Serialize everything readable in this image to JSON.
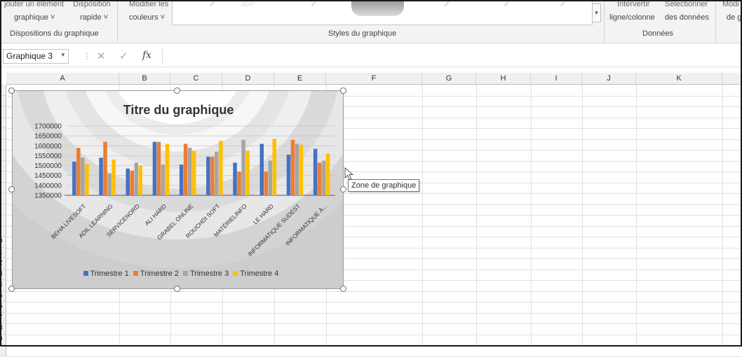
{
  "ribbon": {
    "top_cutoff_1": "jouter un élément",
    "top_cutoff_2": "Disposition",
    "add_element_label": "graphique ˅",
    "quick_layout_label": "rapide ˅",
    "top_cutoff_3": "Modifier les",
    "change_colors_label": "couleurs ˅",
    "switch_top": "Intervertir",
    "switch_label": "ligne/colonne",
    "select_top": "Sélectionner",
    "select_label": "des données",
    "change_top": "Modi",
    "change_label": "de g",
    "group_layouts": "Dispositions du graphique",
    "group_styles": "Styles du graphique",
    "group_data": "Données"
  },
  "formula_bar": {
    "name_box": "Graphique 3",
    "fx": "fx",
    "cancel_icon": "✕",
    "enter_icon": "✓",
    "dots": "⋮"
  },
  "columns": [
    "A",
    "B",
    "C",
    "D",
    "E",
    "F",
    "G",
    "H",
    "I",
    "J",
    "K"
  ],
  "rows": [
    "",
    "",
    "",
    "",
    "",
    "",
    "",
    "",
    "",
    "",
    "",
    "",
    "",
    "",
    "0",
    "1",
    "2",
    "3",
    "4",
    "5",
    "6",
    "7",
    "8",
    "9",
    ""
  ],
  "tooltip": "Zone de graphique",
  "chart_data": {
    "type": "bar",
    "title": "Titre du graphique",
    "categories": [
      "BEHA LIVESOFT",
      "ADIL LEARNING",
      "SERVICENORD",
      "ALI HARD",
      "GRABEL ONLINE",
      "ROUCHDI SOFT",
      "MATÉRIELINFO",
      "LE HARD",
      "INFORMATIQUE SUDEST",
      "INFORMATIQUE À..."
    ],
    "yticks": [
      "1700000",
      "1650000",
      "1600000",
      "1550000",
      "1500000",
      "1450000",
      "1400000",
      "1350000"
    ],
    "ylim": [
      1350000,
      1700000
    ],
    "series": [
      {
        "name": "Trimestre 1",
        "color": "#4472c4",
        "values": [
          1520000,
          1540000,
          1485000,
          1620000,
          1505000,
          1545000,
          1515000,
          1610000,
          1555000,
          1585000
        ]
      },
      {
        "name": "Trimestre 2",
        "color": "#ed7d31",
        "values": [
          1590000,
          1620000,
          1475000,
          1620000,
          1610000,
          1545000,
          1470000,
          1470000,
          1630000,
          1515000
        ]
      },
      {
        "name": "Trimestre 3",
        "color": "#a5a5a5",
        "values": [
          1540000,
          1460000,
          1515000,
          1505000,
          1590000,
          1570000,
          1630000,
          1525000,
          1610000,
          1525000
        ]
      },
      {
        "name": "Trimestre 4",
        "color": "#ffc000",
        "values": [
          1510000,
          1530000,
          1500000,
          1610000,
          1575000,
          1625000,
          1575000,
          1635000,
          1605000,
          1560000
        ]
      }
    ],
    "legend_position": "bottom",
    "grid": true
  }
}
